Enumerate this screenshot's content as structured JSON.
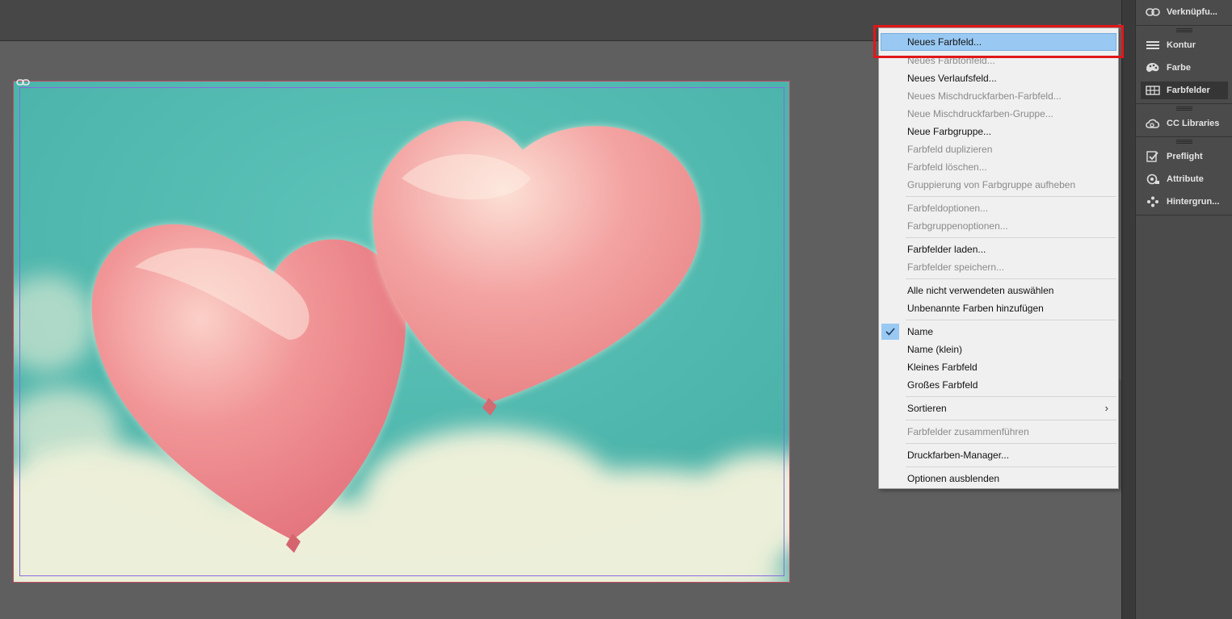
{
  "panel": {
    "items": [
      {
        "label": "Verknüpfu...",
        "icon": "link-icon"
      },
      {
        "label": "Kontur",
        "icon": "stroke-icon"
      },
      {
        "label": "Farbe",
        "icon": "color-palette-icon"
      },
      {
        "label": "Farbfelder",
        "icon": "swatches-icon"
      },
      {
        "label": "CC Libraries",
        "icon": "creative-cloud-icon"
      },
      {
        "label": "Preflight",
        "icon": "preflight-icon"
      },
      {
        "label": "Attribute",
        "icon": "attribute-icon"
      },
      {
        "label": "Hintergrun...",
        "icon": "background-tasks-icon"
      }
    ],
    "active": "Farbfelder"
  },
  "menu": {
    "items": [
      {
        "label": "Neues Farbfeld...",
        "enabled": true,
        "highlighted": true
      },
      {
        "label": "Neues Farbtonfeld...",
        "enabled": false
      },
      {
        "label": "Neues Verlaufsfeld...",
        "enabled": true
      },
      {
        "label": "Neues Mischdruckfarben-Farbfeld...",
        "enabled": false
      },
      {
        "label": "Neue Mischdruckfarben-Gruppe...",
        "enabled": false
      },
      {
        "label": "Neue Farbgruppe...",
        "enabled": true
      },
      {
        "label": "Farbfeld duplizieren",
        "enabled": false
      },
      {
        "label": "Farbfeld löschen...",
        "enabled": false
      },
      {
        "label": "Gruppierung von Farbgruppe aufheben",
        "enabled": false
      },
      {
        "label": "Farbfeldoptionen...",
        "enabled": false
      },
      {
        "label": "Farbgruppenoptionen...",
        "enabled": false
      },
      {
        "label": "Farbfelder laden...",
        "enabled": true
      },
      {
        "label": "Farbfelder speichern...",
        "enabled": false
      },
      {
        "label": "Alle nicht verwendeten auswählen",
        "enabled": true
      },
      {
        "label": "Unbenannte Farben hinzufügen",
        "enabled": true
      },
      {
        "label": "Name",
        "enabled": true,
        "checked": true
      },
      {
        "label": "Name (klein)",
        "enabled": true
      },
      {
        "label": "Kleines Farbfeld",
        "enabled": true
      },
      {
        "label": "Großes Farbfeld",
        "enabled": true
      },
      {
        "label": "Sortieren",
        "enabled": true,
        "submenu": true
      },
      {
        "label": "Farbfelder zusammenführen",
        "enabled": false
      },
      {
        "label": "Druckfarben-Manager...",
        "enabled": true
      },
      {
        "label": "Optionen ausblenden",
        "enabled": true
      }
    ]
  },
  "colors": {
    "highlight": "#99c9f3",
    "callout": "#e0171a",
    "sky": "#4fb7ae",
    "balloon": "#ef8a8e"
  },
  "document": {
    "image_content": "two pink heart balloons against teal sky"
  }
}
